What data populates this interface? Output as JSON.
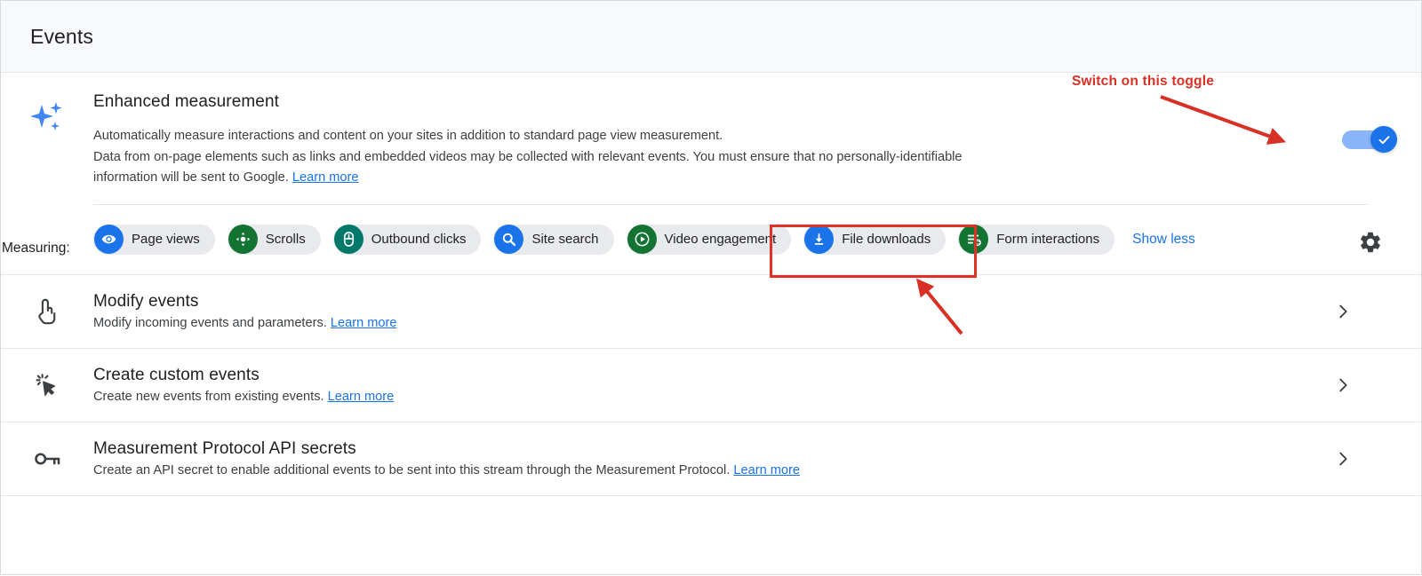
{
  "header": {
    "title": "Events"
  },
  "enhanced_measurement": {
    "icon": "sparkle-icon",
    "title": "Enhanced measurement",
    "desc_line1": "Automatically measure interactions and content on your sites in addition to standard page view measurement.",
    "desc_line2": "Data from on-page elements such as links and embedded videos may be collected with relevant events. You must ensure that no personally-identifiable",
    "desc_line3": "information will be sent to Google. ",
    "learn_more": "Learn more",
    "toggle": {
      "name": "enhanced-measurement-toggle",
      "state": "on",
      "track_color": "#8ab4f8",
      "knob_color": "#1a73e8"
    },
    "measuring_label": "Measuring:",
    "chips": [
      {
        "label": "Page views",
        "icon": "eye-icon",
        "color": "#1a73e8"
      },
      {
        "label": "Scrolls",
        "icon": "scroll-target-icon",
        "color": "#137333"
      },
      {
        "label": "Outbound clicks",
        "icon": "mouse-icon",
        "color": "#00796b"
      },
      {
        "label": "Site search",
        "icon": "search-icon",
        "color": "#1a73e8"
      },
      {
        "label": "Video engagement",
        "icon": "play-icon",
        "color": "#137333"
      },
      {
        "label": "File downloads",
        "icon": "download-icon",
        "color": "#1a73e8"
      },
      {
        "label": "Form interactions",
        "icon": "form-plus-icon",
        "color": "#137333"
      }
    ],
    "show_less": "Show less",
    "settings_icon": "gear-icon"
  },
  "rows": [
    {
      "icon": "tap-hand-icon",
      "title": "Modify events",
      "subtitle": "Modify incoming events and parameters. ",
      "learn_more": "Learn more",
      "chevron": "chevron-right-icon"
    },
    {
      "icon": "click-cursor-icon",
      "title": "Create custom events",
      "subtitle": "Create new events from existing events. ",
      "learn_more": "Learn more",
      "chevron": "chevron-right-icon"
    },
    {
      "icon": "key-icon",
      "title": "Measurement Protocol API secrets",
      "subtitle": "Create an API secret to enable additional events to be sent into this stream through the Measurement Protocol. ",
      "learn_more": "Learn more",
      "chevron": "chevron-right-icon"
    }
  ],
  "annotations": {
    "callout_text": "Switch on this toggle",
    "callout_color": "#d93025",
    "highlight_color": "#e03127",
    "highlight_target": "Video engagement"
  }
}
